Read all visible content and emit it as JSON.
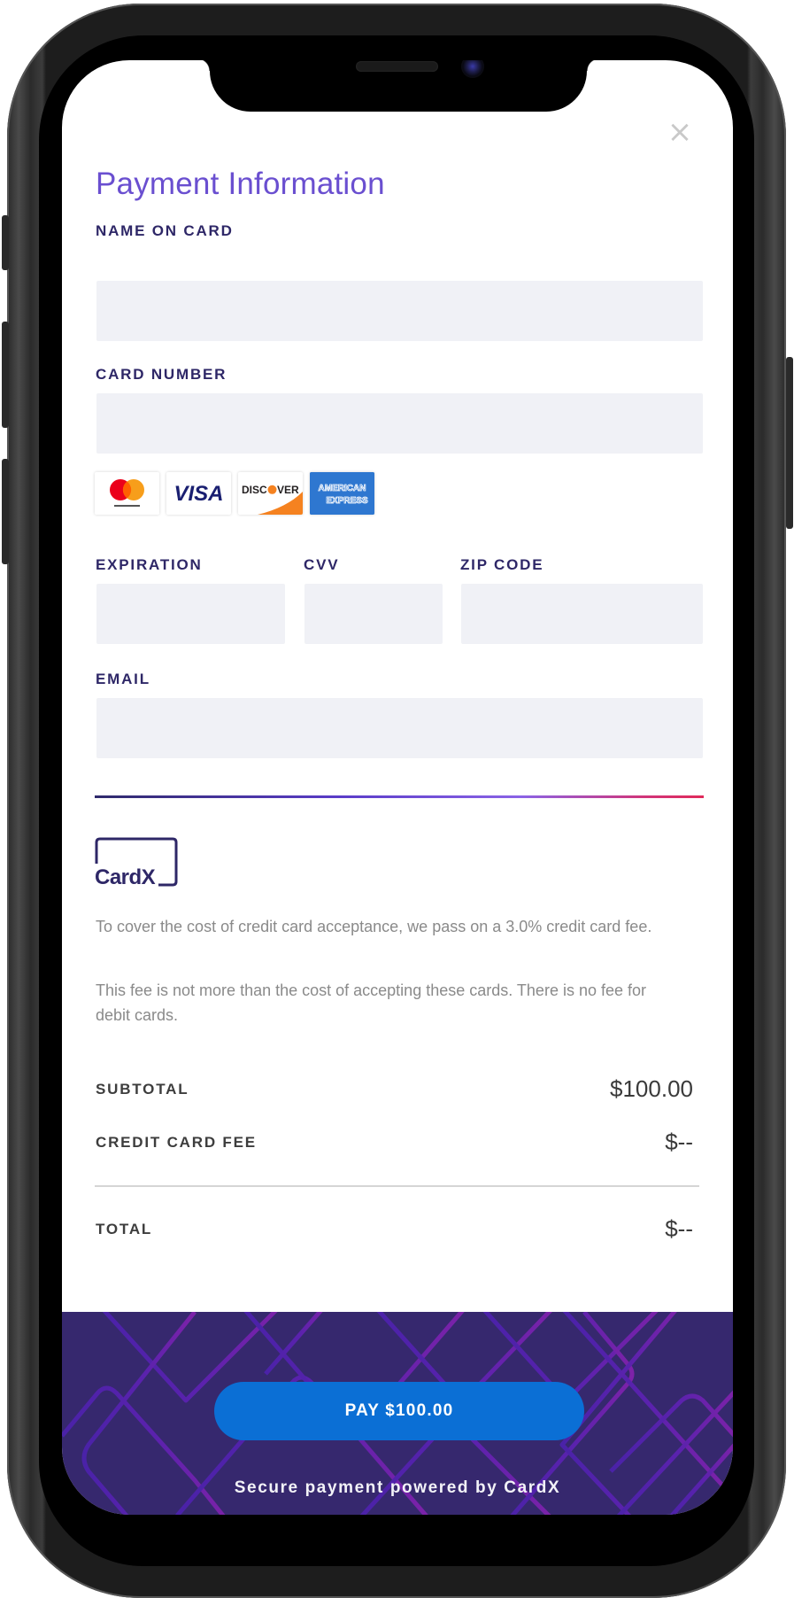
{
  "header": {
    "title": "Payment Information",
    "close_icon": "×"
  },
  "form": {
    "name_on_card": {
      "label": "NAME ON CARD",
      "value": "",
      "placeholder": ""
    },
    "card_number": {
      "label": "CARD NUMBER",
      "value": "",
      "placeholder": ""
    },
    "accepted_cards": [
      {
        "name": "Mastercard",
        "icon": "mastercard-logo"
      },
      {
        "name": "VISA",
        "icon": "visa-logo"
      },
      {
        "name": "DISCOVER",
        "icon": "discover-logo"
      },
      {
        "name": "AMERICAN EXPRESS",
        "icon": "amex-logo"
      }
    ],
    "expiration": {
      "label": "EXPIRATION",
      "value": "",
      "placeholder": ""
    },
    "cvv": {
      "label": "CVV",
      "value": "",
      "placeholder": ""
    },
    "zip_code": {
      "label": "ZIP CODE",
      "value": "",
      "placeholder": ""
    },
    "email": {
      "label": "EMAIL",
      "value": "",
      "placeholder": ""
    }
  },
  "brand": {
    "logo_text": "CardX",
    "colors": {
      "title": "#6a4fd0",
      "label": "#2e2767",
      "field_bg": "#f0f1f6",
      "footer_bg": "#36286e",
      "pay_button": "#0b6fd5",
      "divider_start": "#2f2a6b",
      "divider_end": "#e02a5a"
    }
  },
  "disclaimer": {
    "paragraph_1": "To cover the cost of credit card acceptance, we pass on a 3.0% credit card fee.",
    "paragraph_2": "This fee is not more than the cost of accepting these cards. There is no fee for debit cards."
  },
  "summary": {
    "subtotal_label": "SUBTOTAL",
    "subtotal_value": "$100.00",
    "fee_label": "CREDIT CARD FEE",
    "fee_value": "$--",
    "total_label": "TOTAL",
    "total_value": "$--"
  },
  "footer": {
    "pay_button_label": "PAY $100.00",
    "powered_by": "Secure payment powered by CardX"
  }
}
